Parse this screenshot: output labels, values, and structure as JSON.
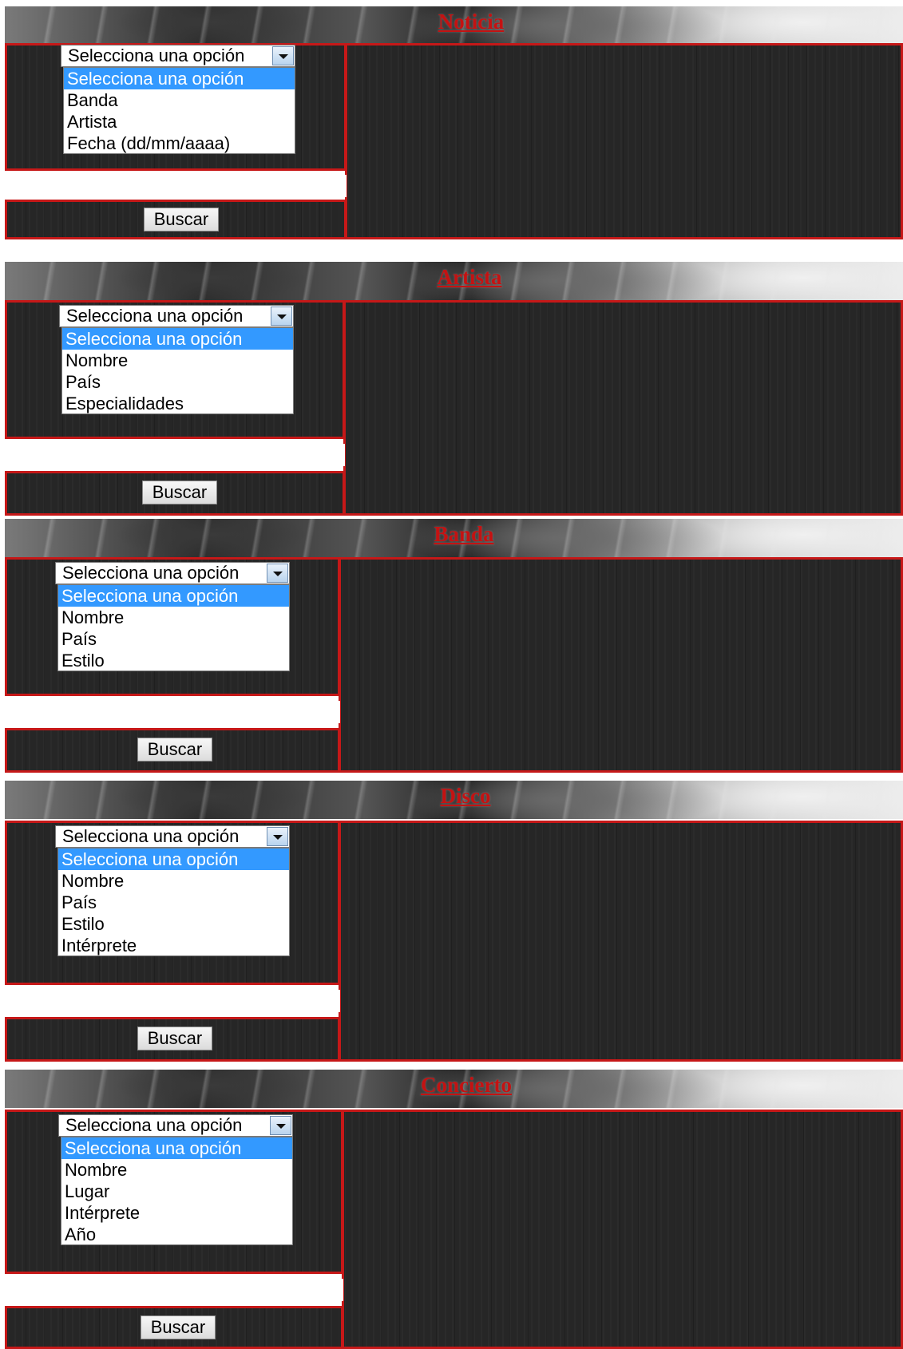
{
  "sections": [
    {
      "title": "Noticia",
      "select_value": "Selecciona una opción",
      "options": [
        "Selecciona una opción",
        "Banda",
        "Artista",
        "Fecha (dd/mm/aaaa)"
      ],
      "search_value": "",
      "button_label": "Buscar"
    },
    {
      "title": "Artista",
      "select_value": "Selecciona una opción",
      "options": [
        "Selecciona una opción",
        "Nombre",
        "País",
        "Especialidades"
      ],
      "search_value": "",
      "button_label": "Buscar"
    },
    {
      "title": "Banda",
      "select_value": "Selecciona una opción",
      "options": [
        "Selecciona una opción",
        "Nombre",
        "País",
        "Estilo"
      ],
      "search_value": "",
      "button_label": "Buscar"
    },
    {
      "title": "Disco",
      "select_value": "Selecciona una opción",
      "options": [
        "Selecciona una opción",
        "Nombre",
        "País",
        "Estilo",
        "Intérprete"
      ],
      "search_value": "",
      "button_label": "Buscar"
    },
    {
      "title": "Concierto",
      "select_value": "Selecciona una opción",
      "options": [
        "Selecciona una opción",
        "Nombre",
        "Lugar",
        "Intérprete",
        "Año"
      ],
      "search_value": "",
      "button_label": "Buscar"
    }
  ],
  "theme": {
    "title_color": "#c41212",
    "border_color": "#c61818",
    "panel_color": "#262626",
    "highlight_color": "#3399ff"
  }
}
